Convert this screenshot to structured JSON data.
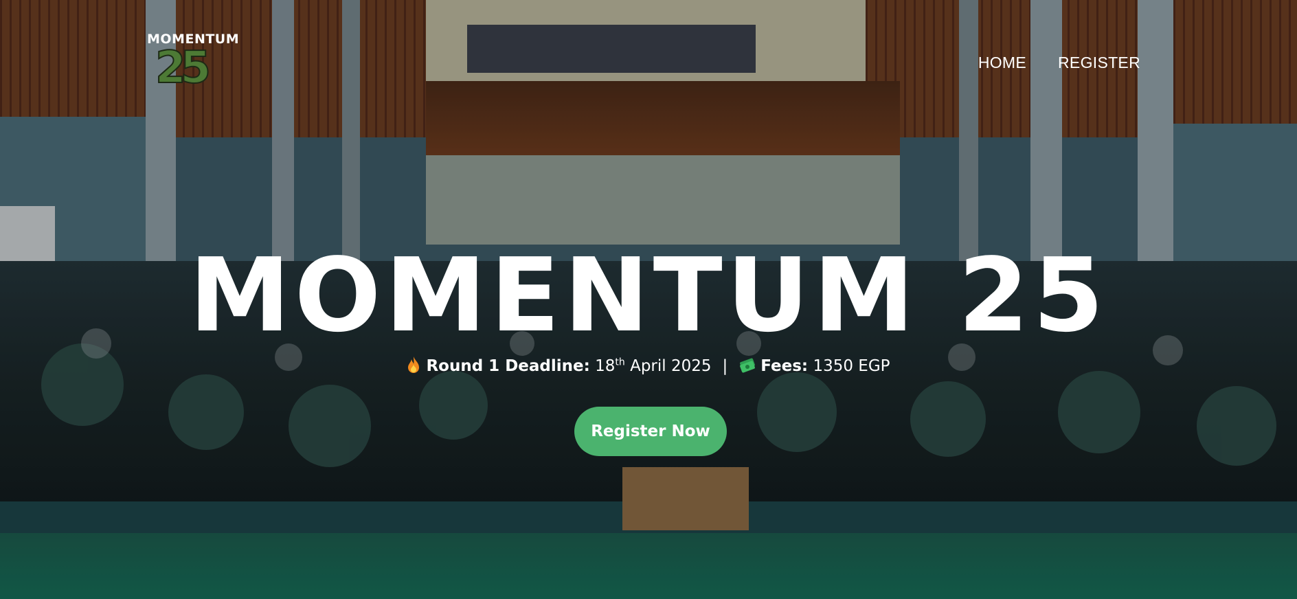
{
  "logo": {
    "word": "MOMENTUM",
    "number": "25"
  },
  "nav": {
    "items": [
      {
        "label": "HOME"
      },
      {
        "label": "REGISTER"
      }
    ]
  },
  "hero": {
    "title": "MOMENTUM 25",
    "deadline": {
      "label": "Round 1 Deadline:",
      "day": "18",
      "day_suffix": "th",
      "rest": " April 2025"
    },
    "separator": "|",
    "fees": {
      "label": "Fees:",
      "value": " 1350 EGP"
    },
    "cta_label": "Register Now"
  },
  "colors": {
    "cta": "#4bb36e",
    "text": "#ffffff",
    "logo_number": "#4d7a35"
  },
  "icons": {
    "deadline": "fire-icon",
    "fees": "money-icon"
  }
}
